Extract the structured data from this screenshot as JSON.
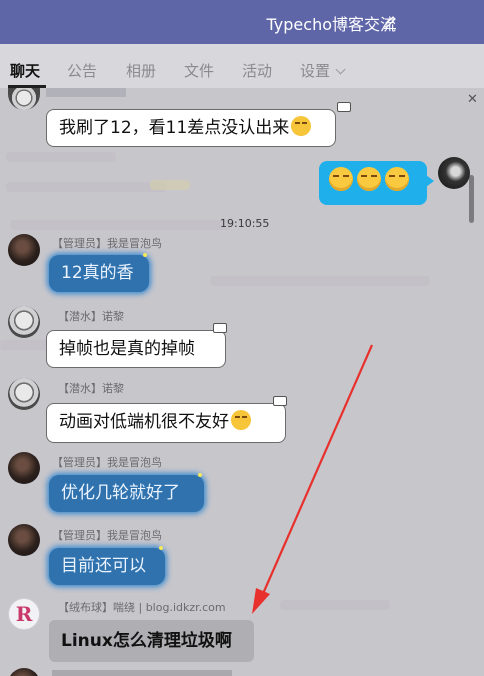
{
  "header": {
    "title": "Typecho博客交流",
    "edit_icon": "edit-icon"
  },
  "tabs": [
    {
      "label": "聊天",
      "active": true
    },
    {
      "label": "公告"
    },
    {
      "label": "相册"
    },
    {
      "label": "文件"
    },
    {
      "label": "活动"
    },
    {
      "label": "设置",
      "dropdown": true
    }
  ],
  "messages": [
    {
      "nick": "【潜水】诺黎",
      "text": "我刷了12，看11差点没认出来",
      "emoji": "laugh-emoji",
      "style": "white"
    },
    {
      "self": true,
      "emoji_count": 3,
      "emoji": "grin-emoji",
      "style": "cyan"
    },
    {
      "time": "19:10:55"
    },
    {
      "nick": "【管理员】我是冒泡鸟",
      "text": "12真的香",
      "style": "blue"
    },
    {
      "nick": "【潜水】诺黎",
      "text": "掉帧也是真的掉帧",
      "style": "white"
    },
    {
      "nick": "【潜水】诺黎",
      "text": "动画对低端机很不友好",
      "emoji": "laugh-emoji",
      "style": "white"
    },
    {
      "nick": "【管理员】我是冒泡鸟",
      "text": "优化几轮就好了",
      "style": "blue"
    },
    {
      "nick": "【管理员】我是冒泡鸟",
      "text": "目前还可以",
      "style": "blue"
    },
    {
      "nick": "【绒布球】喘绕 | blog.idkzr.com",
      "text": "Linux怎么清理垃圾啊",
      "style": "gray"
    }
  ],
  "colors": {
    "header": "#5f66a8",
    "blue_bubble": "#2f72ad",
    "cyan_bubble": "#1fb0ec",
    "arrow": "#e8302c"
  }
}
